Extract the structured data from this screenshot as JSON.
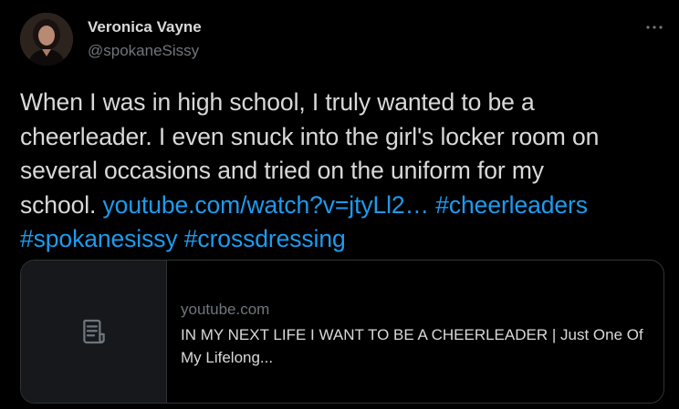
{
  "author": {
    "name": "Veronica Vayne",
    "handle": "@spokaneSissy"
  },
  "menu": {
    "icon": "more-horizontal-icon"
  },
  "tweet": {
    "line1": "When I was in high school, I truly wanted to be a",
    "line2": "cheerleader.  I even snuck into the girl's locker room on",
    "line3": "several occasions and tried on the uniform for my",
    "line4_text": "school.  ",
    "link_url": "youtube.com/watch?v=jtyLl2…",
    "hashtag1": "#cheerleaders",
    "hashtag2": "#spokanesissy",
    "hashtag3": "#crossdressing"
  },
  "card": {
    "domain": "youtube.com",
    "title": "IN MY NEXT LIFE I WANT TO BE A CHEERLEADER | Just One Of My Lifelong...",
    "thumb_icon": "document-icon"
  },
  "colors": {
    "background": "#000000",
    "text": "#d9d9d9",
    "muted": "#6e767d",
    "link": "#1d9bf0",
    "border": "#2f3336",
    "card_thumb_bg": "#16181c"
  }
}
